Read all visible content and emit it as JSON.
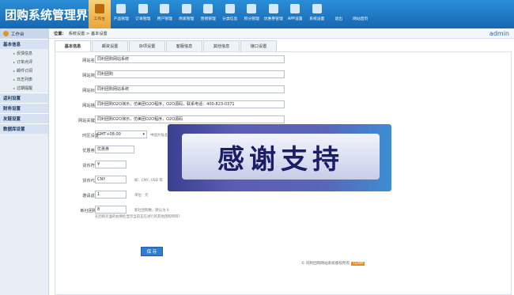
{
  "app": {
    "title": "团购系统管理界面"
  },
  "nav": [
    {
      "label": "工作台",
      "icon": "book-icon",
      "active": true
    },
    {
      "label": "产品管理",
      "icon": "monitor-icon"
    },
    {
      "label": "订单管理",
      "icon": "tools-icon"
    },
    {
      "label": "用户管理",
      "icon": "wrench-icon"
    },
    {
      "label": "商家管理",
      "icon": "chart-icon"
    },
    {
      "label": "营销管理",
      "icon": "network-icon"
    },
    {
      "label": "分类信息",
      "icon": "printer-icon"
    },
    {
      "label": "积分管理",
      "icon": "folder-icon"
    },
    {
      "label": "优惠券管理",
      "icon": "tools-icon"
    },
    {
      "label": "APP设置",
      "icon": "wrench-icon"
    },
    {
      "label": "系统设置",
      "icon": "wrench-icon"
    },
    {
      "label": "退出",
      "icon": "exit-icon"
    },
    {
      "label": "网站首页",
      "icon": "home-icon"
    }
  ],
  "sidebar": {
    "header": "工作台",
    "sections": [
      {
        "title": "基本信息",
        "items": [
          "反馈信息",
          "订单点评",
          "邮件订阅",
          "日志列表",
          "过期提醒"
        ]
      },
      {
        "title": "返利设置",
        "items": []
      },
      {
        "title": "财务设置",
        "items": []
      },
      {
        "title": "友链设置",
        "items": []
      },
      {
        "title": "数据库设置",
        "items": []
      }
    ]
  },
  "breadcrumb": {
    "prefix": "位置：",
    "path": "系统设置 > 基本设置"
  },
  "user": "admin",
  "tabs": [
    "基本信息",
    "邮资设置",
    "杂项设置",
    "客服信息",
    "其他信息",
    "接口设置"
  ],
  "form": {
    "site_name": {
      "label": "网站名称",
      "value": "同利团购网站系统"
    },
    "site_abbr": {
      "label": "网站简称",
      "value": "同利团购"
    },
    "site_title": {
      "label": "网站标题",
      "value": "同利团购网站系统"
    },
    "site_desc": {
      "label": "网站描述",
      "value": "同利团购O2O演示，仿美团O2O程序，O2O源码，联系电话：400-823-0371"
    },
    "site_keywords": {
      "label": "网站关键词",
      "value": "同利团购O2O演示，仿美团O2O程序，O2O源码"
    },
    "timezone": {
      "label": "时区设置",
      "value": "GMT+08:00",
      "hint": "中国大陆北京时间"
    },
    "coupon_name": {
      "label": "优惠券名",
      "value": "优惠券"
    },
    "currency_symbol": {
      "label": "货币符号",
      "value": "¥"
    },
    "currency_code": {
      "label": "货币代码",
      "value": "CNY",
      "hint": "如：CNY, USD 等"
    },
    "invite_rebate": {
      "label": "邀请返利",
      "value": "1",
      "hint": "单位：元"
    },
    "new_deals": {
      "label": "新社团购?",
      "value": "8",
      "hint": "新社团购数，默认为 0",
      "sub_hint": "在团购页面的右侧栏显示当前正在进行的其他团购项目?"
    },
    "save_label": "保 存"
  },
  "footer": {
    "text": "© 同利团购网站系统版权所有",
    "badge": "TEAM"
  },
  "overlay": {
    "text": "感谢支持"
  }
}
